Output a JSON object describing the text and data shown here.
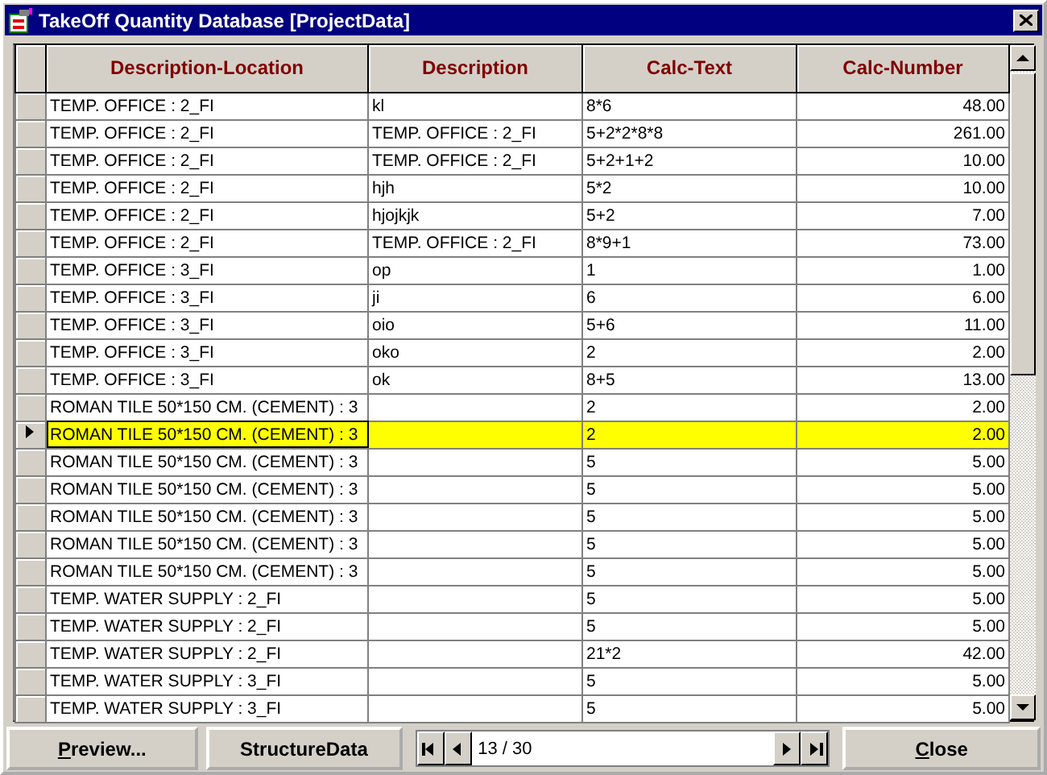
{
  "window": {
    "title": "TakeOff Quantity Database [ProjectData]"
  },
  "table": {
    "columns": [
      "Description-Location",
      "Description",
      "Calc-Text",
      "Calc-Number"
    ],
    "rows": [
      {
        "selected": false,
        "cells": [
          "TEMP. OFFICE : 2_FI",
          "kl",
          "8*6",
          "48.00"
        ]
      },
      {
        "selected": false,
        "cells": [
          "TEMP. OFFICE : 2_FI",
          "TEMP. OFFICE : 2_FI",
          "5+2*2*8*8",
          "261.00"
        ]
      },
      {
        "selected": false,
        "cells": [
          "TEMP. OFFICE : 2_FI",
          "TEMP. OFFICE : 2_FI",
          "5+2+1+2",
          "10.00"
        ]
      },
      {
        "selected": false,
        "cells": [
          "TEMP. OFFICE : 2_FI",
          "hjh",
          "5*2",
          "10.00"
        ]
      },
      {
        "selected": false,
        "cells": [
          "TEMP. OFFICE : 2_FI",
          "hjojkjk",
          "5+2",
          "7.00"
        ]
      },
      {
        "selected": false,
        "cells": [
          "TEMP. OFFICE : 2_FI",
          "TEMP. OFFICE : 2_FI",
          "8*9+1",
          "73.00"
        ]
      },
      {
        "selected": false,
        "cells": [
          "TEMP. OFFICE : 3_FI",
          "op",
          "1",
          "1.00"
        ]
      },
      {
        "selected": false,
        "cells": [
          "TEMP. OFFICE : 3_FI",
          "ji",
          "6",
          "6.00"
        ]
      },
      {
        "selected": false,
        "cells": [
          "TEMP. OFFICE : 3_FI",
          "oio",
          "5+6",
          "11.00"
        ]
      },
      {
        "selected": false,
        "cells": [
          "TEMP. OFFICE : 3_FI",
          "oko",
          "2",
          "2.00"
        ]
      },
      {
        "selected": false,
        "cells": [
          "TEMP. OFFICE : 3_FI",
          "ok",
          "8+5",
          "13.00"
        ]
      },
      {
        "selected": false,
        "cells": [
          "ROMAN TILE 50*150 CM. (CEMENT) : 3",
          "",
          "2",
          "2.00"
        ]
      },
      {
        "selected": true,
        "cells": [
          "ROMAN TILE 50*150 CM. (CEMENT) : 3",
          "",
          "2",
          "2.00"
        ]
      },
      {
        "selected": false,
        "cells": [
          "ROMAN TILE 50*150 CM. (CEMENT) : 3",
          "",
          "5",
          "5.00"
        ]
      },
      {
        "selected": false,
        "cells": [
          "ROMAN TILE 50*150 CM. (CEMENT) : 3",
          "",
          "5",
          "5.00"
        ]
      },
      {
        "selected": false,
        "cells": [
          "ROMAN TILE 50*150 CM. (CEMENT) : 3",
          "",
          "5",
          "5.00"
        ]
      },
      {
        "selected": false,
        "cells": [
          "ROMAN TILE 50*150 CM. (CEMENT) : 3",
          "",
          "5",
          "5.00"
        ]
      },
      {
        "selected": false,
        "cells": [
          "ROMAN TILE 50*150 CM. (CEMENT) : 3",
          "",
          "5",
          "5.00"
        ]
      },
      {
        "selected": false,
        "cells": [
          "TEMP. WATER SUPPLY : 2_FI",
          "",
          "5",
          "5.00"
        ]
      },
      {
        "selected": false,
        "cells": [
          "TEMP. WATER SUPPLY : 2_FI",
          "",
          "5",
          "5.00"
        ]
      },
      {
        "selected": false,
        "cells": [
          "TEMP. WATER SUPPLY : 2_FI",
          "",
          "21*2",
          "42.00"
        ]
      },
      {
        "selected": false,
        "cells": [
          "TEMP. WATER SUPPLY : 3_FI",
          "",
          "5",
          "5.00"
        ]
      },
      {
        "selected": false,
        "cells": [
          "TEMP. WATER SUPPLY : 3_FI",
          "",
          "5",
          "5.00"
        ]
      }
    ]
  },
  "buttons": [
    {
      "label": "Preview...",
      "first_letter_underlined": true
    },
    {
      "label": "StructureData",
      "first_letter_underlined": false
    }
  ],
  "navigator": {
    "position": "13 / 30"
  },
  "close_button": {
    "label": "Close",
    "first_letter_underlined": true
  }
}
